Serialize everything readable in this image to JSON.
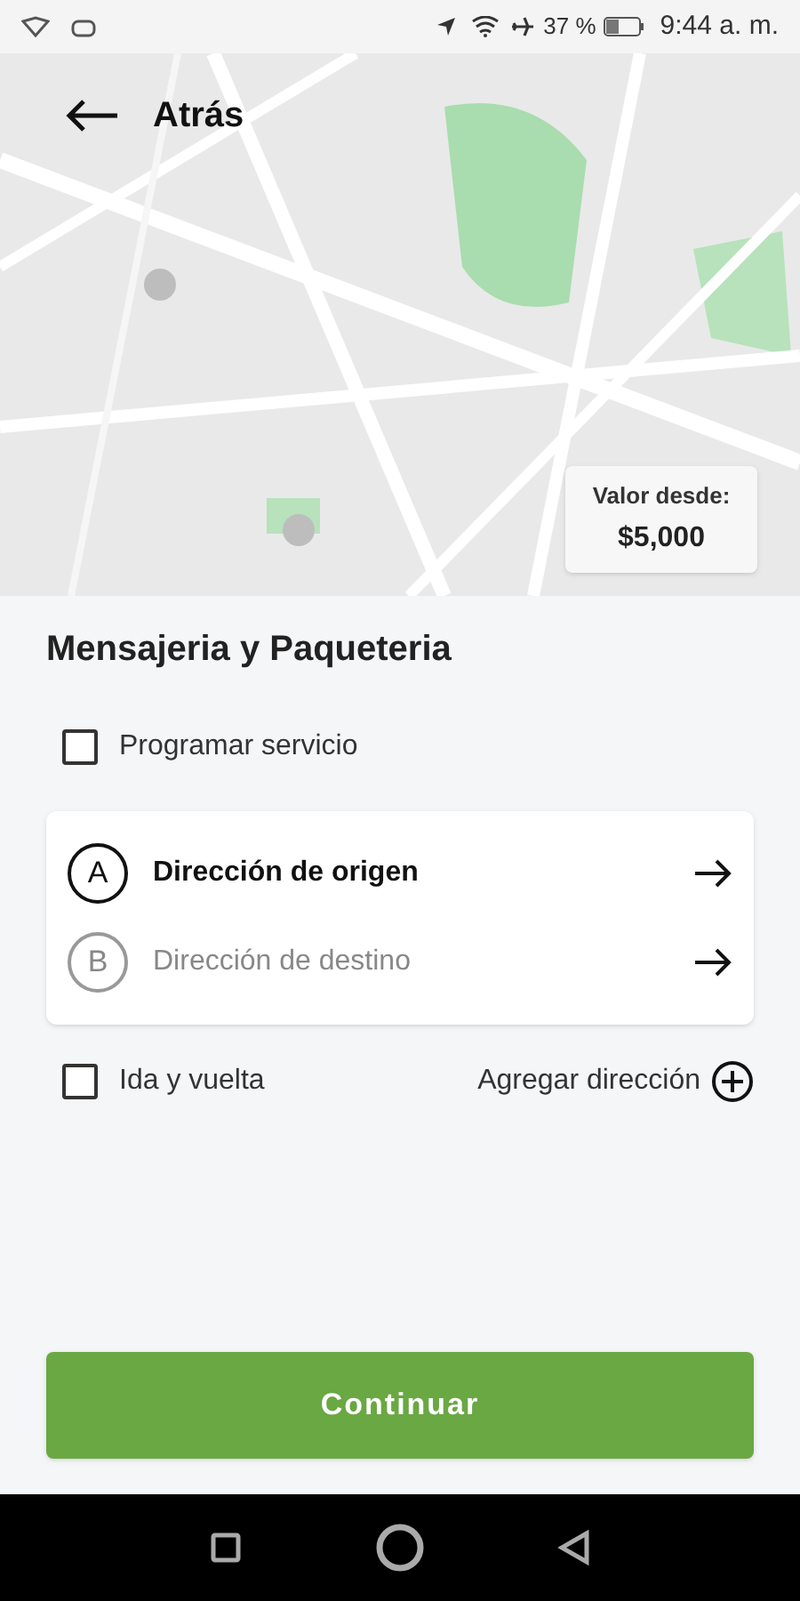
{
  "status_bar": {
    "battery": "37 %",
    "time": "9:44 a. m."
  },
  "header": {
    "back_label": "Atrás"
  },
  "price_badge": {
    "label": "Valor desde:",
    "value": "$5,000"
  },
  "title": "Mensajeria y Paqueteria",
  "schedule": {
    "label": "Programar servicio",
    "checked": false
  },
  "route": [
    {
      "marker": "A",
      "label": "Dirección de origen",
      "active": true
    },
    {
      "marker": "B",
      "label": "Dirección de destino",
      "active": false
    }
  ],
  "round_trip": {
    "label": "Ida y vuelta",
    "checked": false
  },
  "add_address": "Agregar dirección",
  "continue_button": "Continuar"
}
